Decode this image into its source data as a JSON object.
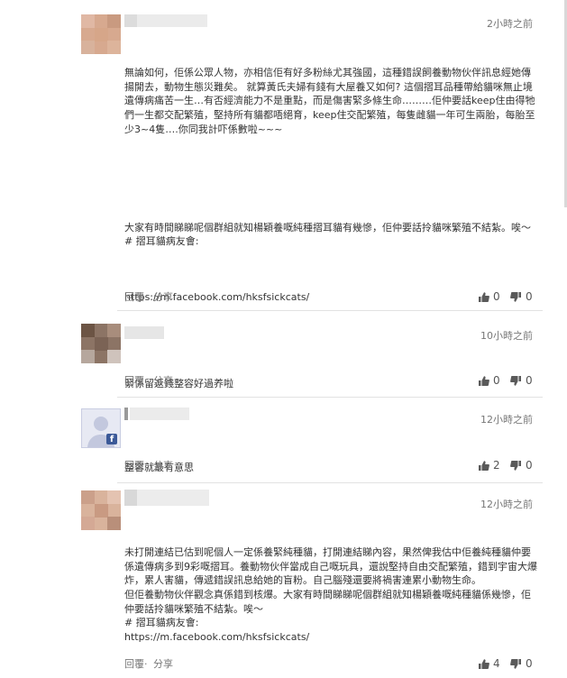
{
  "colors": {
    "accent": "#3b5998",
    "muted": "#777777",
    "text": "#333333"
  },
  "actions": {
    "reply": "回覆",
    "dot": "‧",
    "share": "分享"
  },
  "comments": [
    {
      "time": "2小時之前",
      "paragraphs": [
        "無論如何，佢係公眾人物，亦相信佢有好多粉絲尤其強國，這種錯誤飼養動物伙伴訊息經她傳揚開去，動物生態災難矣。 就算黃氏夫婦有錢有大屋養又如何? 這個摺耳品種帶給貓咪無止境遺傳病痛苦一生…有否經濟能力不是重點，而是傷害緊多條生命………佢仲要話keep住由得牠們一生都交配繁殖，堅持所有貓都唔絕育，keep住交配繁殖，每隻雌貓一年可生兩胎，每胎至少3~4隻….你同我計吓係數啦~~~",
        "",
        "大家有時間睇睇呢個群組就知楊穎養嘅純種摺耳貓有幾慘，佢仲要話拎貓咪繁殖不結紮。唉～\n# 摺耳貓病友會:",
        "https://m.facebook.com/hksfsickcats/"
      ],
      "likes": "0",
      "dislikes": "0",
      "icons": {
        "like": "thumbs-up-icon",
        "dislike": "thumbs-down-icon"
      }
    },
    {
      "time": "10小時之前",
      "paragraphs": [
        "緊係留返錢整容好過养啦"
      ],
      "likes": "0",
      "dislikes": "0"
    },
    {
      "time": "12小時之前",
      "paragraphs": [
        "整容就最有意思"
      ],
      "likes": "2",
      "dislikes": "0",
      "badge": "f"
    },
    {
      "time": "12小時之前",
      "paragraphs": [
        "未打開連結已估到呢個人一定係養緊純種貓，打開連結睇內容，果然俾我估中佢養純種貓仲要係遺傳病多到9彩嘅摺耳。養動物伙伴當成自己嘅玩具，還說堅持自由交配繁殖，錯到宇宙大爆炸，累人害貓，傳遞錯誤訊息給她的盲粉。自己腦殘還要將禍害連累小動物生命。\n但佢養動物伙伴觀念真係錯到核爆。大家有時間睇睇呢個群組就知楊穎養嘅純種貓係幾慘，佢仲要話拎貓咪繁殖不結紮。唉～\n# 摺耳貓病友會:\nhttps://m.facebook.com/hksfsickcats/"
      ],
      "likes": "4",
      "dislikes": "0"
    }
  ]
}
